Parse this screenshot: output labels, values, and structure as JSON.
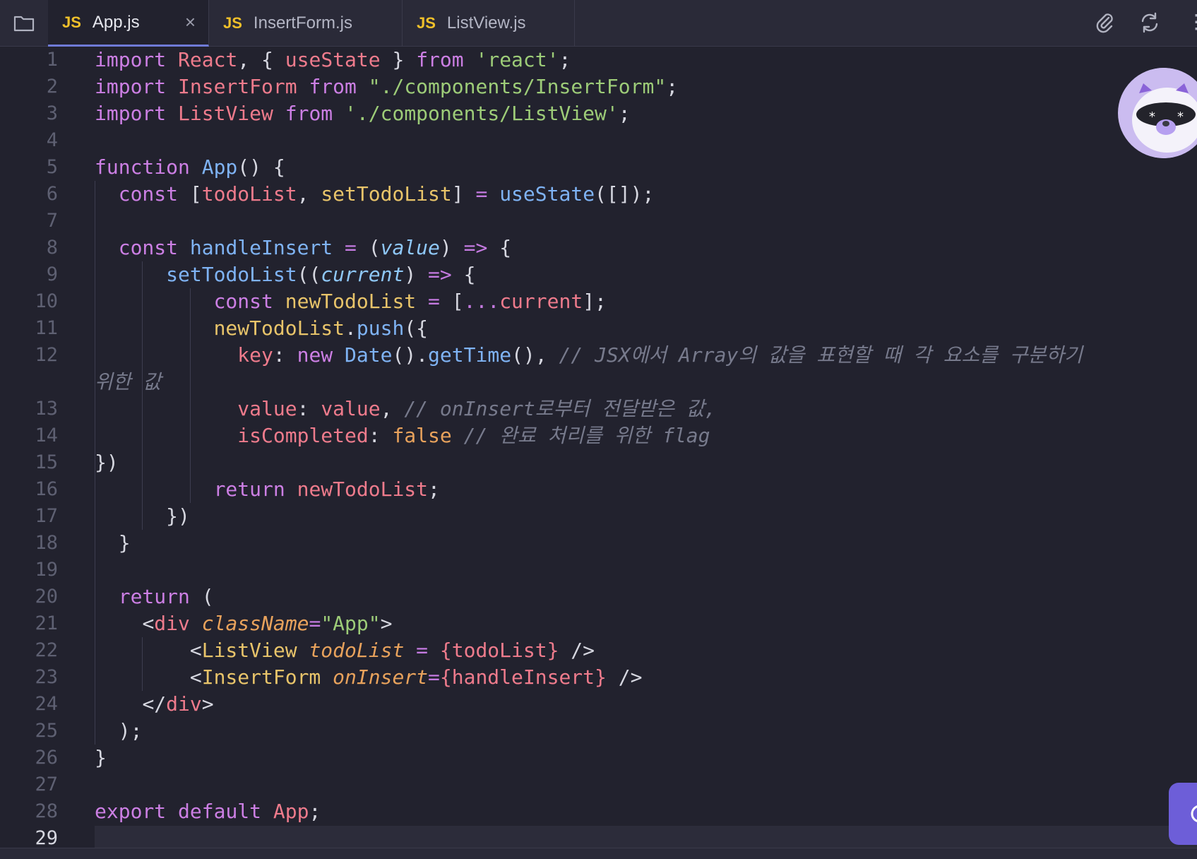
{
  "tabs": [
    {
      "badge": "JS",
      "name": "App.js",
      "close": "×"
    },
    {
      "badge": "JS",
      "name": "InsertForm.js"
    },
    {
      "badge": "JS",
      "name": "ListView.js"
    }
  ],
  "toolbar": {
    "more": "⋮"
  },
  "icons": {
    "folder": "folder-icon",
    "attach": "paperclip-icon",
    "sync": "refresh-icon",
    "avatar": "raccoon-mascot-avatar",
    "chat": "chat-icon"
  },
  "colors": {
    "background": "#22222e",
    "tabbar": "#2a2a38",
    "keyword": "#cc7fe4",
    "variable": "#ee7b8c",
    "function": "#7fb3f4",
    "string": "#9dcc78",
    "comment": "#777a8c",
    "accent": "#6f7bd6"
  },
  "current_line": 29,
  "editor": {
    "line_numbers": [
      "1",
      "2",
      "3",
      "4",
      "5",
      "6",
      "7",
      "8",
      "9",
      "10",
      "11",
      "12",
      "13",
      "14",
      "15",
      "16",
      "17",
      "18",
      "19",
      "20",
      "21",
      "22",
      "23",
      "24",
      "25",
      "26",
      "27",
      "28",
      "29"
    ],
    "lines": [
      [
        [
          "kw",
          "import"
        ],
        [
          "pun",
          " "
        ],
        [
          "var",
          "React"
        ],
        [
          "pun",
          ", { "
        ],
        [
          "var",
          "useState"
        ],
        [
          "pun",
          " } "
        ],
        [
          "kw",
          "from"
        ],
        [
          "pun",
          " "
        ],
        [
          "str",
          "'react'"
        ],
        [
          "pun",
          ";"
        ]
      ],
      [
        [
          "kw",
          "import"
        ],
        [
          "pun",
          " "
        ],
        [
          "var",
          "InsertForm"
        ],
        [
          "pun",
          " "
        ],
        [
          "kw",
          "from"
        ],
        [
          "pun",
          " "
        ],
        [
          "str",
          "\"./components/InsertForm\""
        ],
        [
          "pun",
          ";"
        ]
      ],
      [
        [
          "kw",
          "import"
        ],
        [
          "pun",
          " "
        ],
        [
          "var",
          "ListView"
        ],
        [
          "pun",
          " "
        ],
        [
          "kw",
          "from"
        ],
        [
          "pun",
          " "
        ],
        [
          "str",
          "'./components/ListView'"
        ],
        [
          "pun",
          ";"
        ]
      ],
      [],
      [
        [
          "kw",
          "function"
        ],
        [
          "pun",
          " "
        ],
        [
          "fn",
          "App"
        ],
        [
          "pun",
          "() {"
        ]
      ],
      [
        [
          "pun",
          "  "
        ],
        [
          "kw",
          "const"
        ],
        [
          "pun",
          " ["
        ],
        [
          "var",
          "todoList"
        ],
        [
          "pun",
          ", "
        ],
        [
          "comp",
          "setTodoList"
        ],
        [
          "pun",
          "] "
        ],
        [
          "op",
          "="
        ],
        [
          "pun",
          " "
        ],
        [
          "fn",
          "useState"
        ],
        [
          "pun",
          "([]);"
        ]
      ],
      [],
      [
        [
          "pun",
          "  "
        ],
        [
          "kw",
          "const"
        ],
        [
          "pun",
          " "
        ],
        [
          "fn",
          "handleInsert"
        ],
        [
          "pun",
          " "
        ],
        [
          "op",
          "="
        ],
        [
          "pun",
          " ("
        ],
        [
          "it",
          "value"
        ],
        [
          "pun",
          ") "
        ],
        [
          "op",
          "=>"
        ],
        [
          "pun",
          " {"
        ]
      ],
      [
        [
          "pun",
          "      "
        ],
        [
          "fn",
          "setTodoList"
        ],
        [
          "pun",
          "(("
        ],
        [
          "it",
          "current"
        ],
        [
          "pun",
          ") "
        ],
        [
          "op",
          "=>"
        ],
        [
          "pun",
          " {"
        ]
      ],
      [
        [
          "pun",
          "          "
        ],
        [
          "kw",
          "const"
        ],
        [
          "pun",
          " "
        ],
        [
          "comp",
          "newTodoList"
        ],
        [
          "pun",
          " "
        ],
        [
          "op",
          "="
        ],
        [
          "pun",
          " ["
        ],
        [
          "op",
          "..."
        ],
        [
          "var",
          "current"
        ],
        [
          "pun",
          "];"
        ]
      ],
      [
        [
          "pun",
          "          "
        ],
        [
          "comp",
          "newTodoList"
        ],
        [
          "pun",
          "."
        ],
        [
          "fn",
          "push"
        ],
        [
          "pun",
          "({"
        ]
      ],
      [
        [
          "pun",
          "            "
        ],
        [
          "prop",
          "key"
        ],
        [
          "pun",
          ": "
        ],
        [
          "kw",
          "new"
        ],
        [
          "pun",
          " "
        ],
        [
          "fn",
          "Date"
        ],
        [
          "pun",
          "()."
        ],
        [
          "fn",
          "getTime"
        ],
        [
          "pun",
          "(), "
        ],
        [
          "cmt",
          "// JSX에서 Array의 값을 표현할 때 각 요소를 구분하기"
        ]
      ],
      [
        [
          "pun",
          "            "
        ],
        [
          "prop",
          "value"
        ],
        [
          "pun",
          ": "
        ],
        [
          "var",
          "value"
        ],
        [
          "pun",
          ", "
        ],
        [
          "cmt",
          "// onInsert로부터 전달받은 값,"
        ]
      ],
      [
        [
          "pun",
          "            "
        ],
        [
          "prop",
          "isCompleted"
        ],
        [
          "pun",
          ": "
        ],
        [
          "bool",
          "false"
        ],
        [
          "pun",
          " "
        ],
        [
          "cmt",
          "// 완료 처리를 위한 flag"
        ]
      ],
      [
        [
          "pun",
          "})"
        ]
      ],
      [
        [
          "pun",
          "          "
        ],
        [
          "kw",
          "return"
        ],
        [
          "pun",
          " "
        ],
        [
          "var",
          "newTodoList"
        ],
        [
          "pun",
          ";"
        ]
      ],
      [
        [
          "pun",
          "      })"
        ]
      ],
      [
        [
          "pun",
          "  }"
        ]
      ],
      [],
      [
        [
          "pun",
          "  "
        ],
        [
          "kw",
          "return"
        ],
        [
          "pun",
          " ("
        ]
      ],
      [
        [
          "pun",
          "    "
        ],
        [
          "ang",
          "<"
        ],
        [
          "tag",
          "div"
        ],
        [
          "pun",
          " "
        ],
        [
          "attr",
          "className"
        ],
        [
          "op",
          "="
        ],
        [
          "str",
          "\"App\""
        ],
        [
          "ang",
          ">"
        ]
      ],
      [
        [
          "pun",
          "        "
        ],
        [
          "ang",
          "<"
        ],
        [
          "comp",
          "ListView"
        ],
        [
          "pun",
          " "
        ],
        [
          "attr",
          "todoList"
        ],
        [
          "pun",
          " "
        ],
        [
          "op",
          "="
        ],
        [
          "pun",
          " "
        ],
        [
          "var",
          "{todoList}"
        ],
        [
          "pun",
          " />"
        ]
      ],
      [
        [
          "pun",
          "        "
        ],
        [
          "ang",
          "<"
        ],
        [
          "comp",
          "InsertForm"
        ],
        [
          "pun",
          " "
        ],
        [
          "attr",
          "onInsert"
        ],
        [
          "op",
          "="
        ],
        [
          "var",
          "{handleInsert}"
        ],
        [
          "pun",
          " />"
        ]
      ],
      [
        [
          "pun",
          "    "
        ],
        [
          "ang",
          "</"
        ],
        [
          "tag",
          "div"
        ],
        [
          "ang",
          ">"
        ]
      ],
      [
        [
          "pun",
          "  );"
        ]
      ],
      [
        [
          "pun",
          "}"
        ]
      ],
      [],
      [
        [
          "kw",
          "export"
        ],
        [
          "pun",
          " "
        ],
        [
          "kw",
          "default"
        ],
        [
          "pun",
          " "
        ],
        [
          "var",
          "App"
        ],
        [
          "pun",
          ";"
        ]
      ],
      []
    ],
    "wrapped_continuation": [
      [
        "cmt",
        "위한 값"
      ]
    ]
  }
}
